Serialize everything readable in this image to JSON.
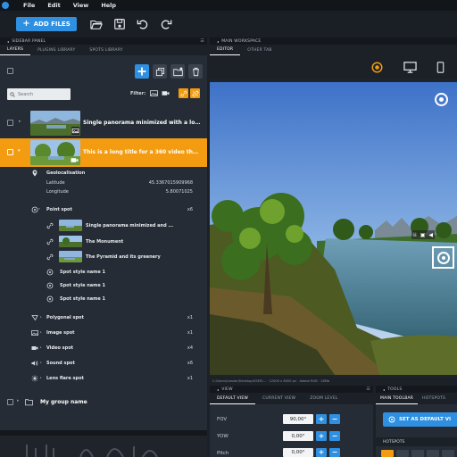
{
  "menubar": {
    "items": [
      "File",
      "Edit",
      "View",
      "Help"
    ]
  },
  "toolbar": {
    "add_files_label": "ADD FILES"
  },
  "sidebar": {
    "panel_title": "SIDEBAR PANEL",
    "tabs": [
      "LAYERS",
      "PLUGINS LIBRARY",
      "SPOTS LIBRARY"
    ],
    "search_placeholder": "Search",
    "filter_label": "Filter:",
    "layers": [
      {
        "title": "Single panorama minimized with a lo..."
      },
      {
        "title": "This is a long title for a 360 video that..."
      }
    ],
    "geoloc": {
      "label": "Geolocalisation",
      "latitude_label": "Latitude",
      "latitude_value": "45.3367015909968",
      "longitude_label": "Longitude",
      "longitude_value": "5.80071025"
    },
    "point_spot": {
      "label": "Point spot",
      "count": "x6"
    },
    "point_items": [
      "Single panorama minimized and ...",
      "The Monument",
      "The Pyramid and its greenery",
      "Spot style name 1",
      "Spot style name 1",
      "Spot style name 1"
    ],
    "spot_types": [
      {
        "label": "Polygonal spot",
        "count": "x1"
      },
      {
        "label": "Image spot",
        "count": "x1"
      },
      {
        "label": "Video spot",
        "count": "x4"
      },
      {
        "label": "Sound spot",
        "count": "x6"
      },
      {
        "label": "Lens flare spot",
        "count": "x1"
      }
    ],
    "group_name": "My group name"
  },
  "workspace": {
    "panel_title": "MAIN WORKSPACE",
    "tabs": [
      "EDITOR",
      "OTHER TAB"
    ],
    "status": "C:/Users/Leader/Desktop/USER/... · 12000 x 6000 px · Adobe RGB · 18Mb"
  },
  "view_panel": {
    "title": "VIEW",
    "tabs": [
      "DEFAULT VIEW",
      "CURRENT VIEW",
      "ZOOM LEVEL"
    ],
    "fields": [
      {
        "label": "FOV",
        "value": "90,00°"
      },
      {
        "label": "YOW",
        "value": "0,00°"
      },
      {
        "label": "Pitch",
        "value": "0,00°"
      }
    ]
  },
  "tools_panel": {
    "title": "TOOLS",
    "tabs": [
      "MAIN TOOLBAR",
      "HOTSPOTS"
    ],
    "set_default_label": "SET AS DEFAULT VI",
    "hotspots_tab": "HOTSPOTS"
  },
  "colors": {
    "accent": "#2f8fe0",
    "selected": "#f39c12",
    "panel": "#262c35"
  }
}
